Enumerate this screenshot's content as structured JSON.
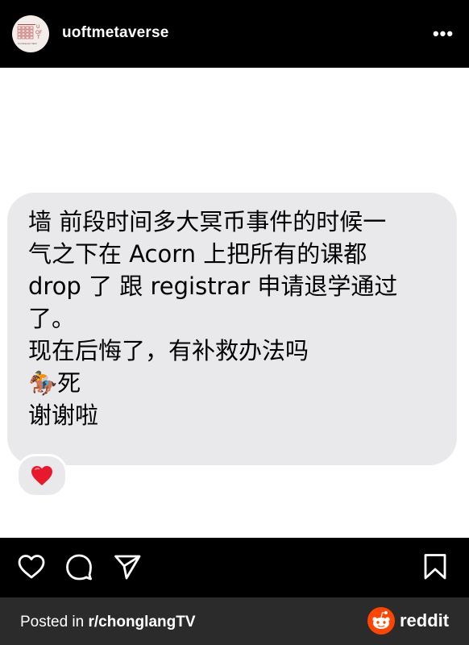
{
  "header": {
    "username": "uoftmetaverse",
    "more_label": "•••",
    "logo_lines": [
      "多伦多大学",
      "U",
      "OF",
      "T",
      "Confession Wall"
    ]
  },
  "post": {
    "message": "墙 前段时间多大冥币事件的时候一\n气之下在 Acorn 上把所有的课都\ndrop 了 跟 registrar 申请退学通过\n了。\n现在后悔了，有补救办法吗\n🏇死\n谢谢啦",
    "reaction": "❤️"
  },
  "actions": {
    "like_icon": "heart-icon",
    "comment_icon": "comment-icon",
    "share_icon": "send-icon",
    "save_icon": "bookmark-icon"
  },
  "footer": {
    "posted_prefix": "Posted in ",
    "subreddit": "r/chonglangTV",
    "brand": "reddit"
  },
  "colors": {
    "bubble": "#e9e9eb",
    "reddit_orange": "#ff4500",
    "footer_bg": "#2b2b2b"
  }
}
